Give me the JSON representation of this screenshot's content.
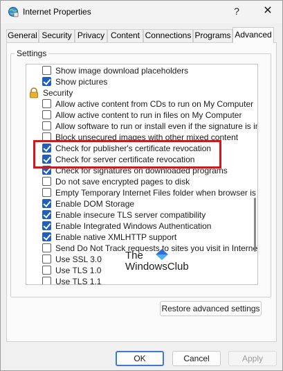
{
  "window": {
    "title": "Internet Properties",
    "help": "?",
    "close": "✕"
  },
  "tabs": [
    {
      "label": "General"
    },
    {
      "label": "Security"
    },
    {
      "label": "Privacy"
    },
    {
      "label": "Content"
    },
    {
      "label": "Connections"
    },
    {
      "label": "Programs"
    },
    {
      "label": "Advanced",
      "active": true
    }
  ],
  "settings": {
    "group_label": "Settings",
    "items": [
      {
        "type": "option",
        "label": "Show image download placeholders",
        "checked": false
      },
      {
        "type": "option",
        "label": "Show pictures",
        "checked": true
      },
      {
        "type": "category",
        "label": "Security",
        "icon": "padlock-icon"
      },
      {
        "type": "option",
        "label": "Allow active content from CDs to run on My Computer",
        "checked": false
      },
      {
        "type": "option",
        "label": "Allow active content to run in files on My Computer",
        "checked": false
      },
      {
        "type": "option",
        "label": "Allow software to run or install even if the signature is inva",
        "checked": false
      },
      {
        "type": "option",
        "label": "Block unsecured images with other mixed content",
        "checked": false
      },
      {
        "type": "option",
        "label": "Check for publisher's certificate revocation",
        "checked": true
      },
      {
        "type": "option",
        "label": "Check for server certificate revocation",
        "checked": true
      },
      {
        "type": "option",
        "label": "Check for signatures on downloaded programs",
        "checked": true
      },
      {
        "type": "option",
        "label": "Do not save encrypted pages to disk",
        "checked": false
      },
      {
        "type": "option",
        "label": "Empty Temporary Internet Files folder when browser is clo",
        "checked": false
      },
      {
        "type": "option",
        "label": "Enable DOM Storage",
        "checked": true
      },
      {
        "type": "option",
        "label": "Enable insecure TLS server compatibility",
        "checked": true
      },
      {
        "type": "option",
        "label": "Enable Integrated Windows Authentication",
        "checked": true
      },
      {
        "type": "option",
        "label": "Enable native XMLHTTP support",
        "checked": true
      },
      {
        "type": "option",
        "label": "Send Do Not Track requests to sites you visit in Internet E",
        "checked": false
      },
      {
        "type": "option",
        "label": "Use SSL 3.0",
        "checked": false
      },
      {
        "type": "option",
        "label": "Use TLS 1.0",
        "checked": false
      },
      {
        "type": "option",
        "label": "Use TLS 1.1",
        "checked": false
      }
    ]
  },
  "watermark": {
    "line1": "The",
    "line2": "WindowsClub"
  },
  "buttons": {
    "restore": "Restore advanced settings",
    "ok": "OK",
    "cancel": "Cancel",
    "apply": "Apply"
  },
  "colors": {
    "accent": "#1f5fbf",
    "highlight": "#d9141b"
  }
}
